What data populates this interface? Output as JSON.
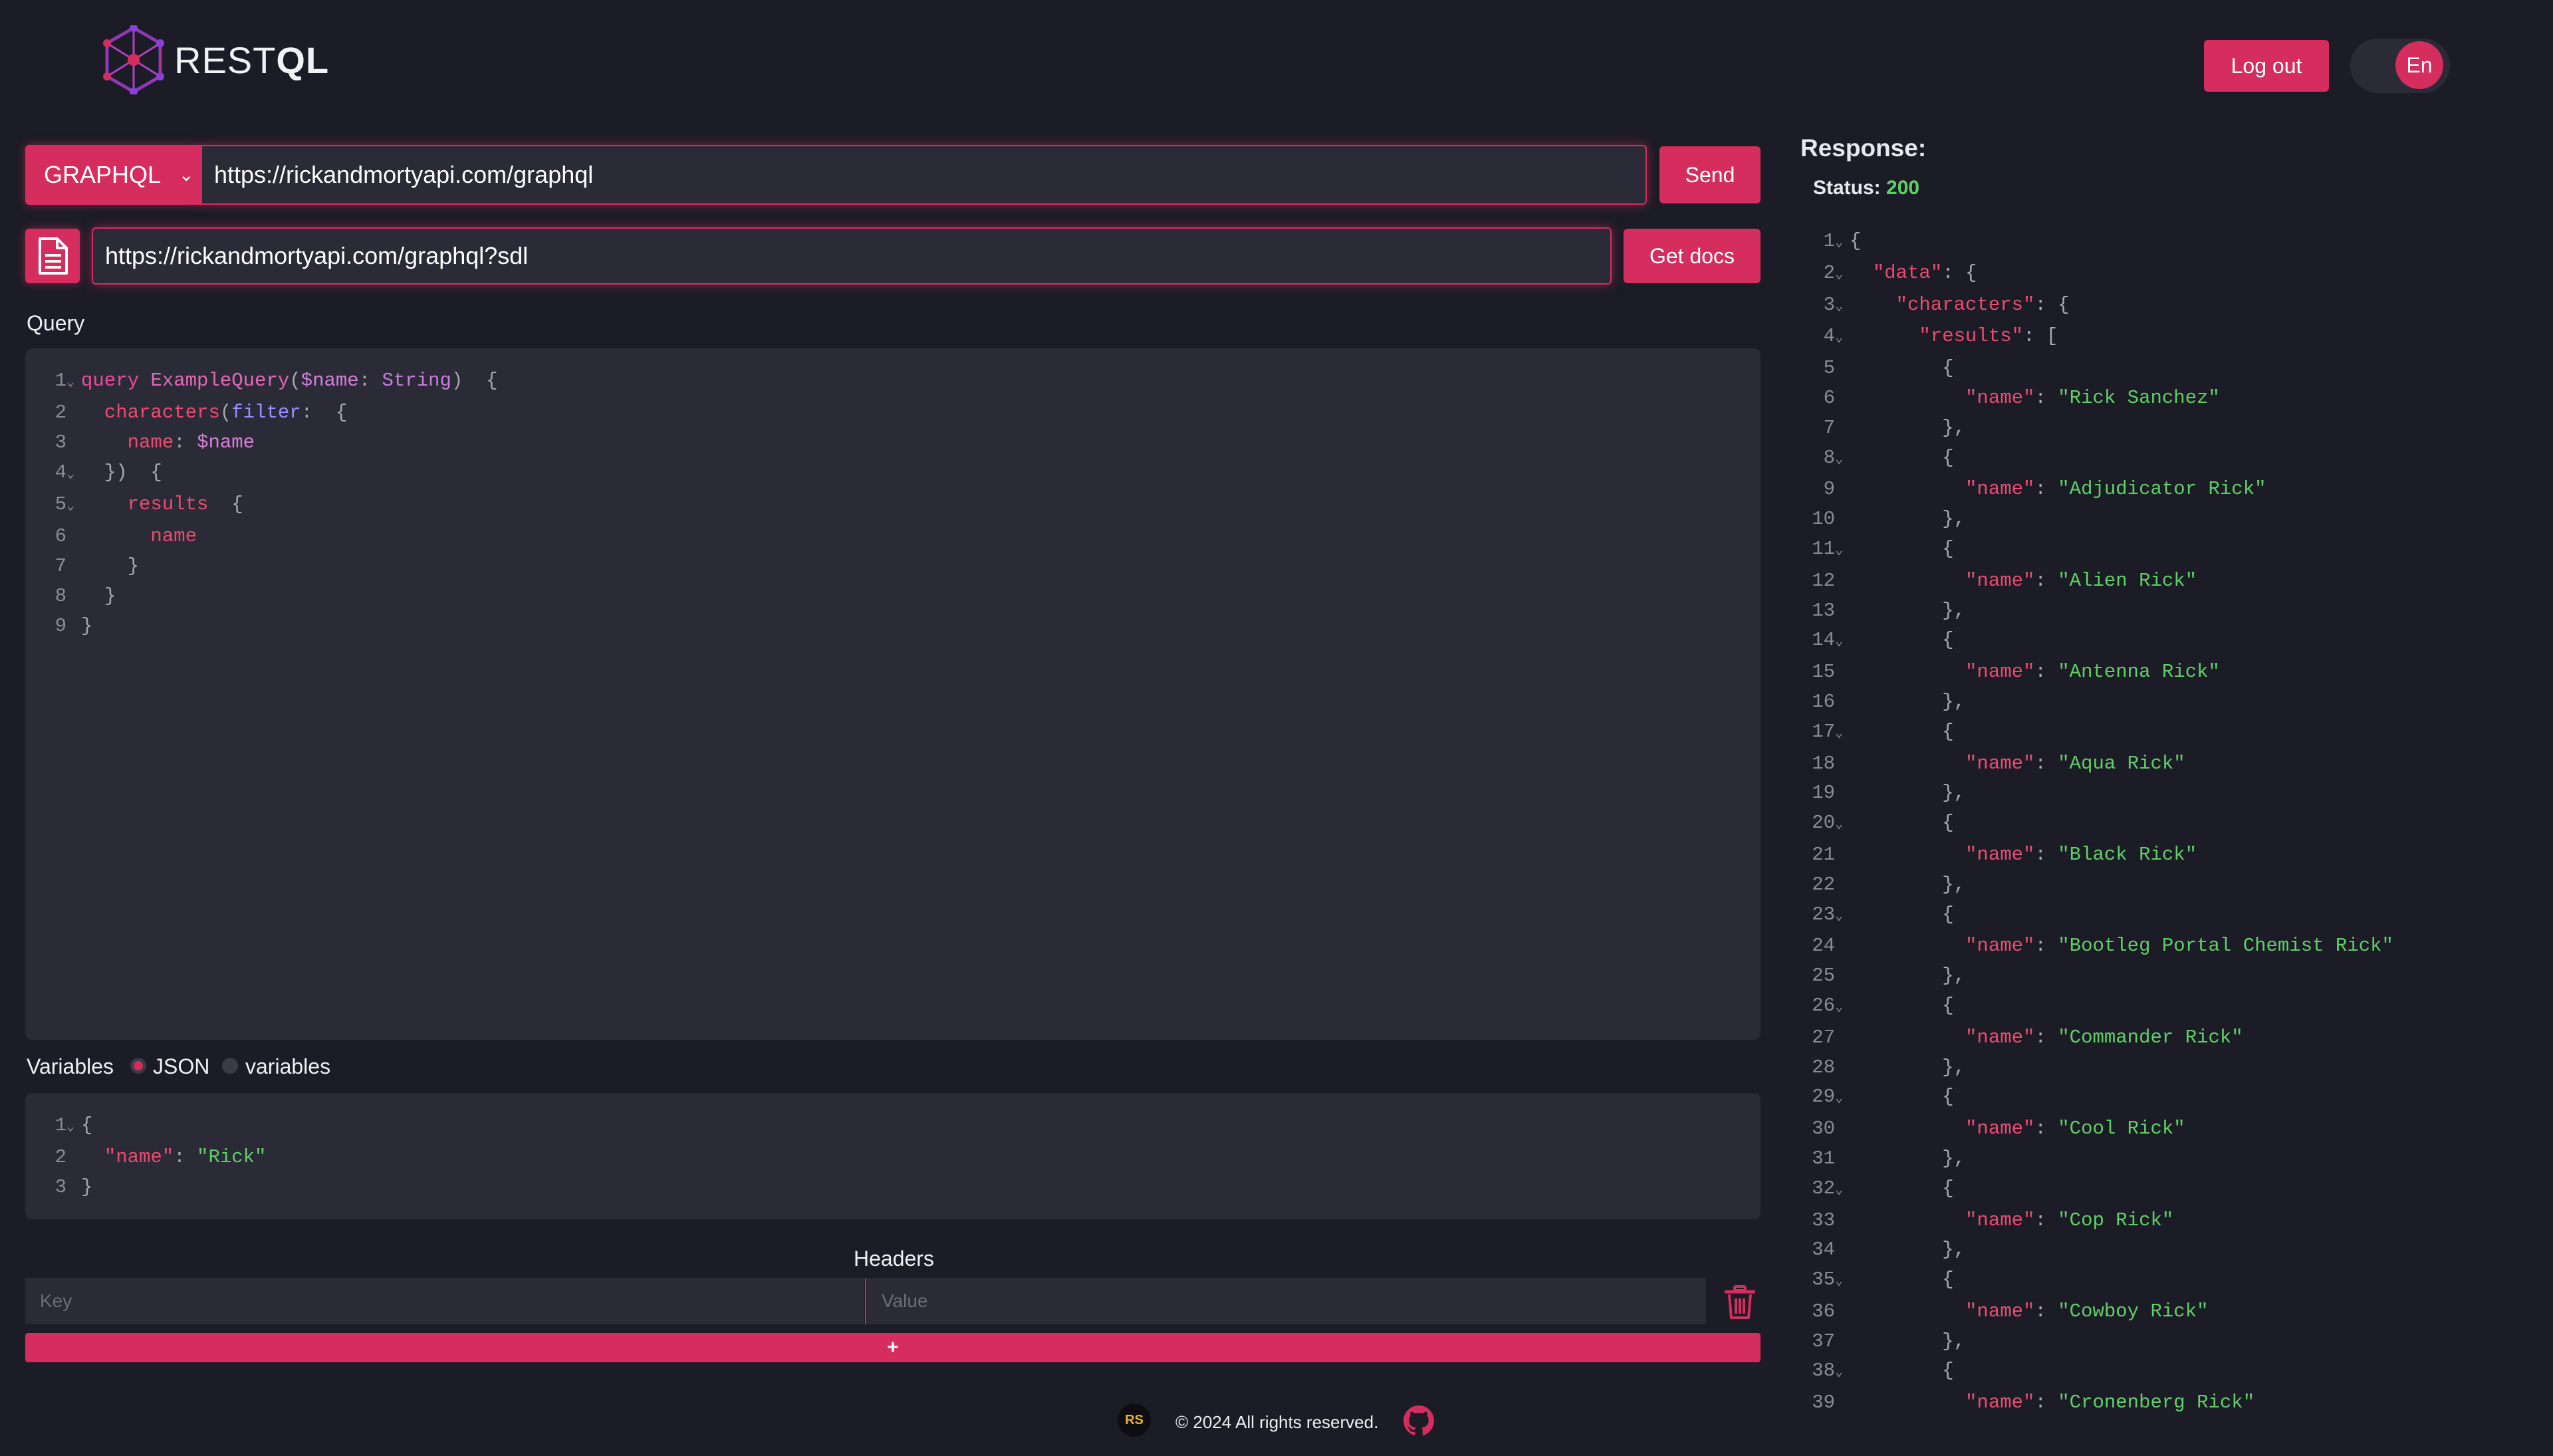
{
  "header": {
    "logo_text_light": "REST",
    "logo_text_bold": "QL",
    "logout_label": "Log out",
    "lang_label": "En"
  },
  "request": {
    "method": "GRAPHQL",
    "url": "https://rickandmortyapi.com/graphql",
    "send_label": "Send",
    "sdl_url": "https://rickandmortyapi.com/graphql?sdl",
    "get_docs_label": "Get docs"
  },
  "query": {
    "label": "Query",
    "lines": [
      "query ExampleQuery($name: String)  {",
      "  characters(filter:  {",
      "    name: $name",
      "  })  {",
      "    results  {",
      "      name",
      "    }",
      "  }",
      "}"
    ]
  },
  "variables": {
    "label": "Variables",
    "mode_json": "JSON",
    "mode_variables": "variables",
    "lines": [
      "{",
      "  \"name\": \"Rick\"",
      "}"
    ]
  },
  "headers": {
    "label": "Headers",
    "key_placeholder": "Key",
    "value_placeholder": "Value",
    "add_label": "+"
  },
  "response": {
    "title": "Response:",
    "status_label": "Status:",
    "status_code": "200",
    "names": [
      "Rick Sanchez",
      "Adjudicator Rick",
      "Alien Rick",
      "Antenna Rick",
      "Aqua Rick",
      "Black Rick",
      "Bootleg Portal Chemist Rick",
      "Commander Rick",
      "Cool Rick",
      "Cop Rick",
      "Cowboy Rick",
      "Cronenberg Rick"
    ]
  },
  "footer": {
    "badge": "RS",
    "copyright": "© 2024 All rights reserved."
  },
  "colors": {
    "background": "#1c1c26",
    "panel": "#2a2b37",
    "accent": "#d42d5e",
    "status_ok": "#5fd068"
  },
  "icons": [
    "logo-icon",
    "document-icon",
    "chevron-down-icon",
    "trash-icon",
    "github-icon"
  ]
}
